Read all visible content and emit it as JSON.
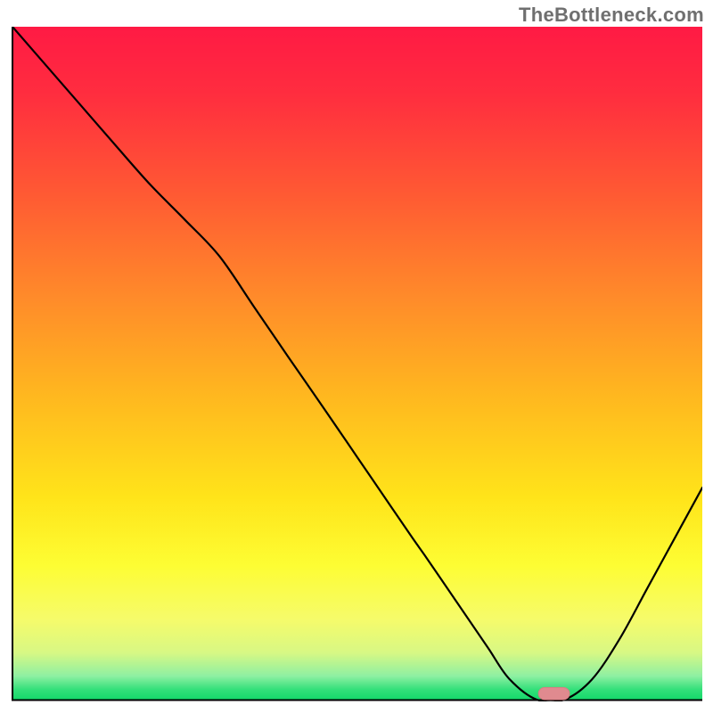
{
  "watermark": "TheBottleneck.com",
  "colors": {
    "gradient_stops": [
      {
        "offset": 0.0,
        "color": "#ff1a44"
      },
      {
        "offset": 0.1,
        "color": "#ff2d3f"
      },
      {
        "offset": 0.25,
        "color": "#ff5a33"
      },
      {
        "offset": 0.4,
        "color": "#ff8a2a"
      },
      {
        "offset": 0.55,
        "color": "#ffb81f"
      },
      {
        "offset": 0.7,
        "color": "#ffe41a"
      },
      {
        "offset": 0.8,
        "color": "#fdfd33"
      },
      {
        "offset": 0.88,
        "color": "#f6fb6a"
      },
      {
        "offset": 0.93,
        "color": "#d8f884"
      },
      {
        "offset": 0.965,
        "color": "#8ef0a2"
      },
      {
        "offset": 0.985,
        "color": "#33e07a"
      },
      {
        "offset": 1.0,
        "color": "#14d96a"
      }
    ],
    "axis": "#000000",
    "curve": "#000000",
    "marker_fill": "#e08a8f",
    "marker_stroke": "#d87d83"
  },
  "chart_data": {
    "type": "line",
    "title": "",
    "xlabel": "",
    "ylabel": "",
    "xlim": [
      0,
      100
    ],
    "ylim": [
      0,
      100
    ],
    "x": [
      0,
      5,
      10,
      15,
      20,
      25,
      30,
      35,
      40,
      45,
      50,
      55,
      58,
      60,
      63,
      66,
      69,
      72,
      76,
      80,
      84,
      88,
      92,
      96,
      100
    ],
    "values": [
      100,
      94.1,
      88.2,
      82.3,
      76.5,
      71.3,
      65.9,
      58.4,
      50.9,
      43.5,
      36.0,
      28.5,
      24.0,
      21.1,
      16.6,
      12.1,
      7.6,
      3.1,
      0.0,
      0.0,
      3.0,
      9.0,
      16.5,
      24.0,
      31.5
    ],
    "marker": {
      "x": 78.5,
      "y": 0,
      "width": 4.5,
      "height": 1.8
    },
    "grid": false,
    "legend": null
  }
}
